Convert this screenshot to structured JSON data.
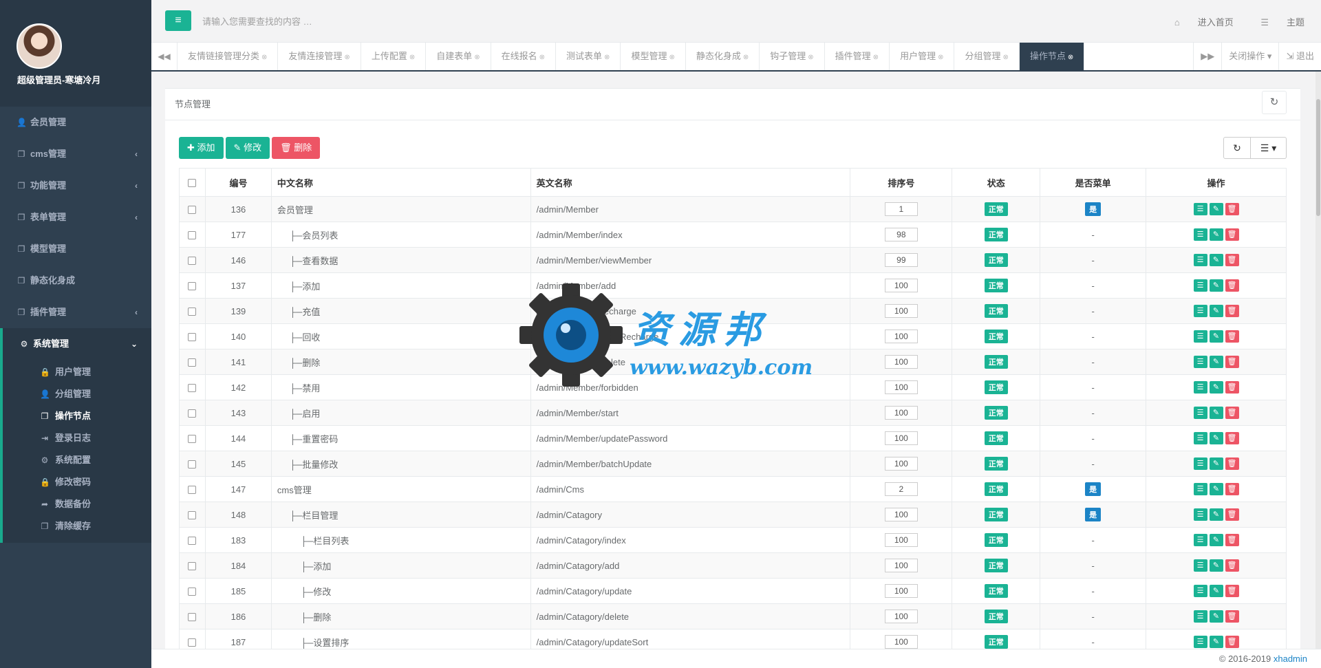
{
  "sidebar": {
    "user_name": "超级管理员-寒塘冷月",
    "items": [
      {
        "label": "会员管理",
        "icon": "user-icon",
        "glyph": "👤",
        "has_arrow": false
      },
      {
        "label": "cms管理",
        "icon": "copy-icon",
        "glyph": "❐",
        "has_arrow": true
      },
      {
        "label": "功能管理",
        "icon": "copy-icon",
        "glyph": "❐",
        "has_arrow": true
      },
      {
        "label": "表单管理",
        "icon": "copy-icon",
        "glyph": "❐",
        "has_arrow": true
      },
      {
        "label": "模型管理",
        "icon": "copy-icon",
        "glyph": "❐",
        "has_arrow": false
      },
      {
        "label": "静态化身成",
        "icon": "copy-icon",
        "glyph": "❐",
        "has_arrow": false
      },
      {
        "label": "插件管理",
        "icon": "copy-icon",
        "glyph": "❐",
        "has_arrow": true
      }
    ],
    "active_section": {
      "label": "系统管理",
      "icon": "cogs-icon"
    },
    "sub_items": [
      {
        "label": "用户管理",
        "icon": "lock-user-icon",
        "glyph": "🔒"
      },
      {
        "label": "分组管理",
        "icon": "user-icon",
        "glyph": "👤"
      },
      {
        "label": "操作节点",
        "icon": "copy-icon",
        "glyph": "❐"
      },
      {
        "label": "登录日志",
        "icon": "sign-in-icon",
        "glyph": "⇥"
      },
      {
        "label": "系统配置",
        "icon": "gear-icon",
        "glyph": "⚙"
      },
      {
        "label": "修改密码",
        "icon": "lock-icon",
        "glyph": "🔒"
      },
      {
        "label": "数据备份",
        "icon": "share-icon",
        "glyph": "➦"
      },
      {
        "label": "清除缓存",
        "icon": "copy-icon",
        "glyph": "❐"
      }
    ],
    "current_sub": "操作节点"
  },
  "topbar": {
    "search_placeholder": "请输入您需要查找的内容 …",
    "home_label": "进入首页",
    "theme_label": "主题"
  },
  "tabs": {
    "items": [
      "友情链接管理分类",
      "友情连接管理",
      "上传配置",
      "自建表单",
      "在线报名",
      "测试表单",
      "模型管理",
      "静态化身成",
      "钩子管理",
      "插件管理",
      "用户管理",
      "分组管理",
      "操作节点"
    ],
    "active": "操作节点",
    "close_ops_label": "关闭操作",
    "logout_label": "退出"
  },
  "panel": {
    "title": "节点管理",
    "add_label": "添加",
    "edit_label": "修改",
    "delete_label": "删除"
  },
  "table": {
    "headers": [
      "编号",
      "中文名称",
      "英文名称",
      "排序号",
      "状态",
      "是否菜单",
      "操作"
    ],
    "status_label": "正常",
    "menu_yes_label": "是",
    "menu_no_label": "-",
    "rows": [
      {
        "id": "136",
        "cn": "会员管理",
        "en": "/admin/Member",
        "sort": "1",
        "menu": true
      },
      {
        "id": "177",
        "cn": "├─会员列表",
        "en": "/admin/Member/index",
        "sort": "98",
        "menu": false
      },
      {
        "id": "146",
        "cn": "├─查看数据",
        "en": "/admin/Member/viewMember",
        "sort": "99",
        "menu": false
      },
      {
        "id": "137",
        "cn": "├─添加",
        "en": "/admin/Member/add",
        "sort": "100",
        "menu": false
      },
      {
        "id": "139",
        "cn": "├─充值",
        "en": "/admin/Member/recharge",
        "sort": "100",
        "menu": false
      },
      {
        "id": "140",
        "cn": "├─回收",
        "en": "/admin/Member/backRecharge",
        "sort": "100",
        "menu": false
      },
      {
        "id": "141",
        "cn": "├─删除",
        "en": "/admin/Member/delete",
        "sort": "100",
        "menu": false
      },
      {
        "id": "142",
        "cn": "├─禁用",
        "en": "/admin/Member/forbidden",
        "sort": "100",
        "menu": false
      },
      {
        "id": "143",
        "cn": "├─启用",
        "en": "/admin/Member/start",
        "sort": "100",
        "menu": false
      },
      {
        "id": "144",
        "cn": "├─重置密码",
        "en": "/admin/Member/updatePassword",
        "sort": "100",
        "menu": false
      },
      {
        "id": "145",
        "cn": "├─批量修改",
        "en": "/admin/Member/batchUpdate",
        "sort": "100",
        "menu": false
      },
      {
        "id": "147",
        "cn": "cms管理",
        "en": "/admin/Cms",
        "sort": "2",
        "menu": true
      },
      {
        "id": "148",
        "cn": "├─栏目管理",
        "en": "/admin/Catagory",
        "sort": "100",
        "menu": true
      },
      {
        "id": "183",
        "cn": "├─栏目列表",
        "en": "/admin/Catagory/index",
        "sort": "100",
        "menu": false
      },
      {
        "id": "184",
        "cn": "├─添加",
        "en": "/admin/Catagory/add",
        "sort": "100",
        "menu": false
      },
      {
        "id": "185",
        "cn": "├─修改",
        "en": "/admin/Catagory/update",
        "sort": "100",
        "menu": false
      },
      {
        "id": "186",
        "cn": "├─删除",
        "en": "/admin/Catagory/delete",
        "sort": "100",
        "menu": false
      },
      {
        "id": "187",
        "cn": "├─设置排序",
        "en": "/admin/Catagory/updateSort",
        "sort": "100",
        "menu": false
      }
    ]
  },
  "watermark": {
    "title": "资源邦",
    "url": "www.wazyb.com"
  },
  "footer": {
    "copyright": "© 2016-2019",
    "brand": "xhadmin"
  },
  "colors": {
    "sidebar_bg": "#2f4050",
    "accent": "#1ab394",
    "danger": "#ed5565",
    "menu_badge": "#1c84c6"
  }
}
